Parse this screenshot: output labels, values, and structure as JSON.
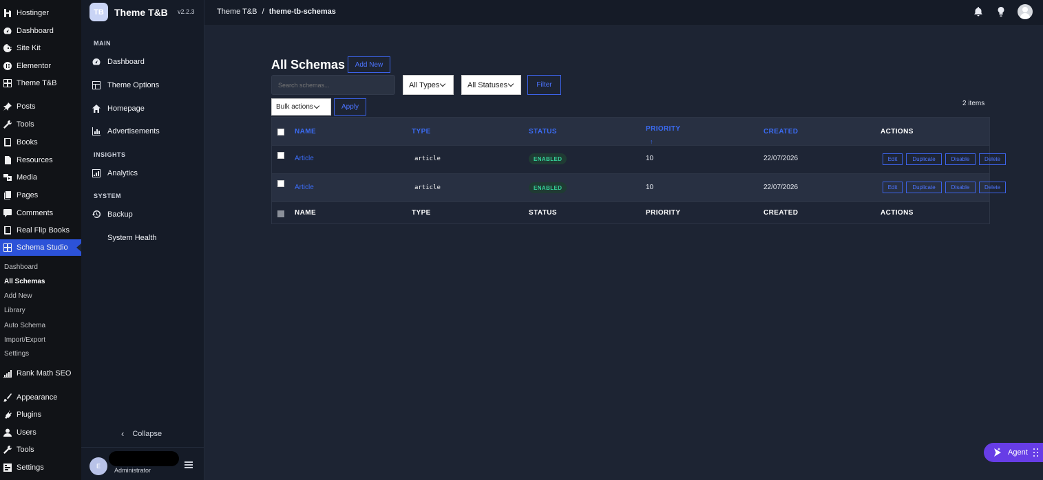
{
  "wp_menu": {
    "items": [
      {
        "label": "Hostinger",
        "icon": "hostinger-icon"
      },
      {
        "label": "Dashboard",
        "icon": "dashboard-icon"
      },
      {
        "label": "Site Kit",
        "icon": "google-icon"
      },
      {
        "label": "Elementor",
        "icon": "elementor-icon"
      },
      {
        "label": "Theme T&B",
        "icon": "grid-icon"
      },
      {
        "label": "Posts",
        "icon": "pin-icon"
      },
      {
        "label": "Tools",
        "icon": "wrench-icon"
      },
      {
        "label": "Books",
        "icon": "book-icon"
      },
      {
        "label": "Resources",
        "icon": "page-icon"
      },
      {
        "label": "Media",
        "icon": "media-icon"
      },
      {
        "label": "Pages",
        "icon": "pages-icon"
      },
      {
        "label": "Comments",
        "icon": "comment-icon"
      },
      {
        "label": "Real Flip Books",
        "icon": "book-icon"
      },
      {
        "label": "Schema Studio",
        "icon": "grid-icon"
      },
      {
        "label": "Rank Math SEO",
        "icon": "chart-icon"
      },
      {
        "label": "Appearance",
        "icon": "brush-icon"
      },
      {
        "label": "Plugins",
        "icon": "plug-icon"
      },
      {
        "label": "Users",
        "icon": "user-icon"
      },
      {
        "label": "Tools",
        "icon": "wrench-icon"
      },
      {
        "label": "Settings",
        "icon": "settings-icon"
      }
    ],
    "submenu": [
      "Dashboard",
      "All Schemas",
      "Add New",
      "Library",
      "Auto Schema",
      "Import/Export",
      "Settings"
    ]
  },
  "plugin": {
    "logo": "TB",
    "name": "Theme T&B",
    "version": "v2.2.3",
    "sections": {
      "main": "MAIN",
      "insights": "INSIGHTS",
      "system": "SYSTEM"
    },
    "nav": {
      "dashboard": "Dashboard",
      "theme_options": "Theme Options",
      "homepage": "Homepage",
      "advertisements": "Advertisements",
      "analytics": "Analytics",
      "backup": "Backup",
      "system_health": "System Health"
    },
    "collapse": "Collapse",
    "user": {
      "initial": "E",
      "role": "Administrator"
    }
  },
  "topbar": {
    "breadcrumb_root": "Theme T&B",
    "breadcrumb_sep": "/",
    "breadcrumb_current": "theme-tb-schemas"
  },
  "main": {
    "title": "All Schemas",
    "add_new": "Add New",
    "search_placeholder": "Search schemas...",
    "type_filter": "All Types",
    "status_filter": "All Statuses",
    "filter_button": "Filter",
    "bulk_actions": "Bulk actions",
    "apply_button": "Apply",
    "items_count": "2 items"
  },
  "table": {
    "headers": {
      "name": "NAME",
      "type": "TYPE",
      "status": "STATUS",
      "priority": "PRIORITY",
      "priority_sort": "↑",
      "created": "CREATED",
      "actions": "ACTIONS"
    },
    "rows": [
      {
        "name": "Article",
        "type": "article",
        "status": "ENABLED",
        "priority": "10",
        "created": "22/07/2026"
      },
      {
        "name": "Article",
        "type": "article",
        "status": "ENABLED",
        "priority": "10",
        "created": "22/07/2026"
      }
    ],
    "actions": {
      "edit": "Edit",
      "duplicate": "Duplicate",
      "disable": "Disable",
      "delete": "Delete"
    }
  },
  "agent": {
    "label": "Agent"
  },
  "colors": {
    "accent": "#3b6cf5",
    "agent": "#673de6",
    "status_enabled": "#35d39a"
  }
}
